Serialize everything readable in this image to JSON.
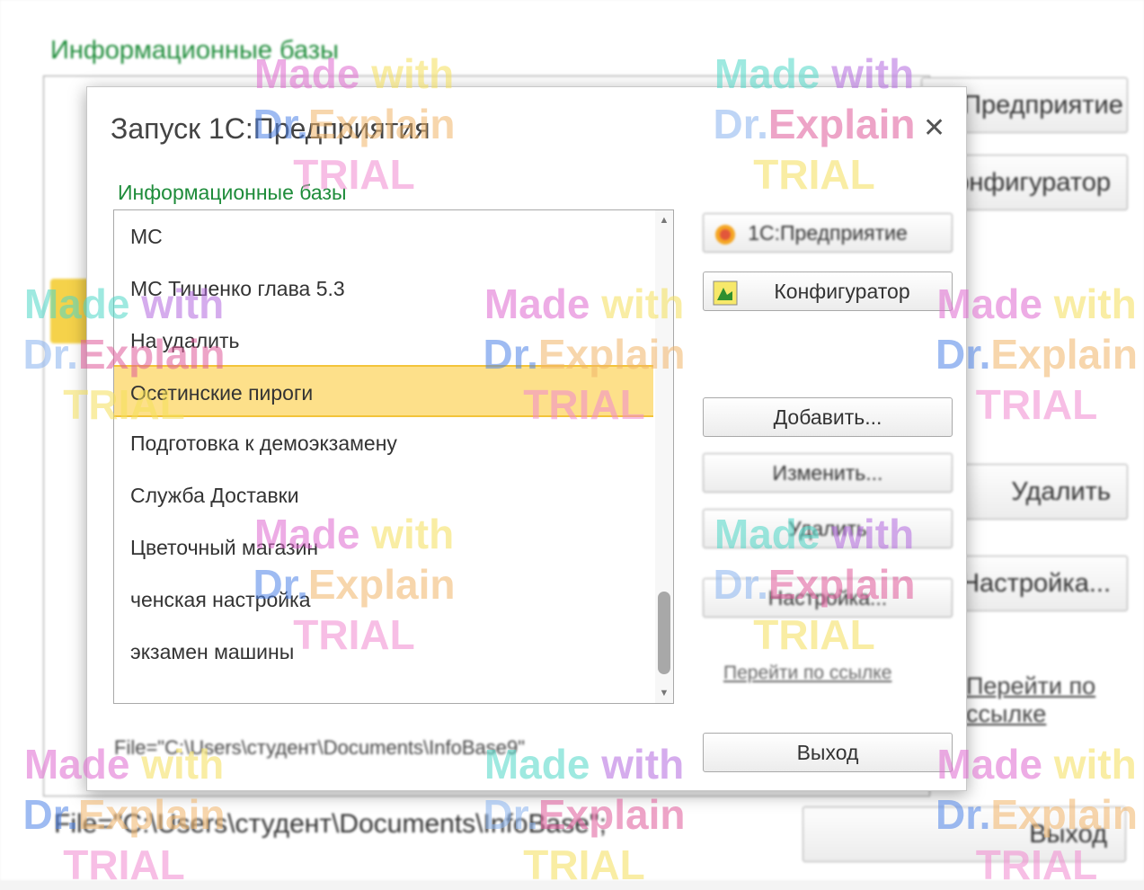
{
  "background": {
    "title": "Информационные базы",
    "buttons": [
      "1С:Предприятие",
      "Конфигуратор",
      "Удалить",
      "Настройка..."
    ],
    "link": "Перейти по ссылке",
    "path": "File=\"C:\\Users\\студент\\Documents\\InfoBase\";",
    "exit": "Выход"
  },
  "dialog": {
    "title": "Запуск 1С:Предприятия",
    "close_icon": "close-icon",
    "subtitle": "Информационные базы",
    "list": {
      "items": [
        {
          "label": "МС"
        },
        {
          "label": "МС Тишенко глава 5.3"
        },
        {
          "label": "На удалить"
        },
        {
          "label": "Осетинские пироги"
        },
        {
          "label": "Подготовка к демоэкзамену"
        },
        {
          "label": "Служба Доставки"
        },
        {
          "label": "Цветочный магазин"
        },
        {
          "label": "ченская настройка"
        },
        {
          "label": "экзамен машины"
        }
      ],
      "selected_index": 3,
      "scroll_position": 0.85
    },
    "path": "File=\"C:\\Users\\студент\\Documents\\InfoBase9\"",
    "buttons": {
      "enterprise": "1С:Предприятие",
      "configurator": "Конфигуратор",
      "add": "Добавить...",
      "edit": "Изменить...",
      "delete": "Удалить",
      "settings": "Настройка...",
      "exit": "Выход"
    },
    "link": "Перейти по ссылке"
  },
  "watermark": {
    "line1": "Made with",
    "line2": "Dr.Explain",
    "line3": "TRIAL"
  }
}
